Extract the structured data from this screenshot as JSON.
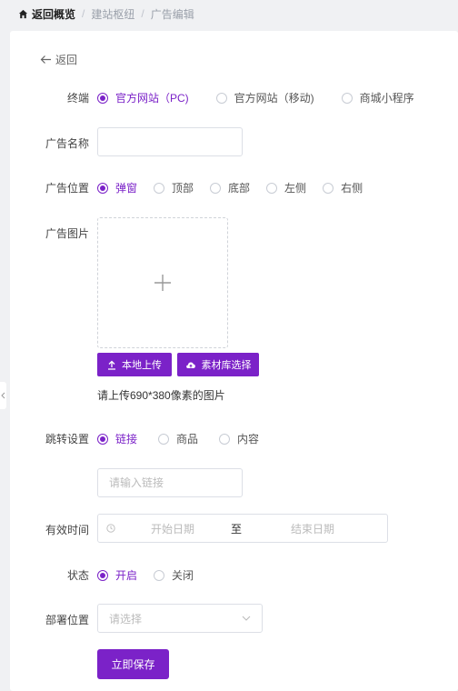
{
  "breadcrumb": {
    "home": "返回概览",
    "items": [
      "建站枢纽",
      "广告编辑"
    ]
  },
  "back_label": "返回",
  "form": {
    "terminal": {
      "label": "终端",
      "options": [
        "官方网站（PC)",
        "官方网站（移动)",
        "商城小程序"
      ],
      "selected": "官方网站（PC)"
    },
    "name": {
      "label": "广告名称",
      "value": "",
      "placeholder": ""
    },
    "position": {
      "label": "广告位置",
      "options": [
        "弹窗",
        "顶部",
        "底部",
        "左侧",
        "右侧"
      ],
      "selected": "弹窗"
    },
    "image": {
      "label": "广告图片",
      "upload_local": "本地上传",
      "library_select": "素材库选择",
      "hint": "请上传690*380像素的图片"
    },
    "jump": {
      "label": "跳转设置",
      "options": [
        "链接",
        "商品",
        "内容"
      ],
      "selected": "链接",
      "link_placeholder": "请输入链接"
    },
    "valid_time": {
      "label": "有效时间",
      "start_placeholder": "开始日期",
      "separator": "至",
      "end_placeholder": "结束日期"
    },
    "status": {
      "label": "状态",
      "options": [
        "开启",
        "关闭"
      ],
      "selected": "开启"
    },
    "deploy": {
      "label": "部署位置",
      "placeholder": "请选择"
    },
    "save_label": "立即保存"
  },
  "colors": {
    "accent": "#7b22c8",
    "background": "#f0f1f3"
  }
}
